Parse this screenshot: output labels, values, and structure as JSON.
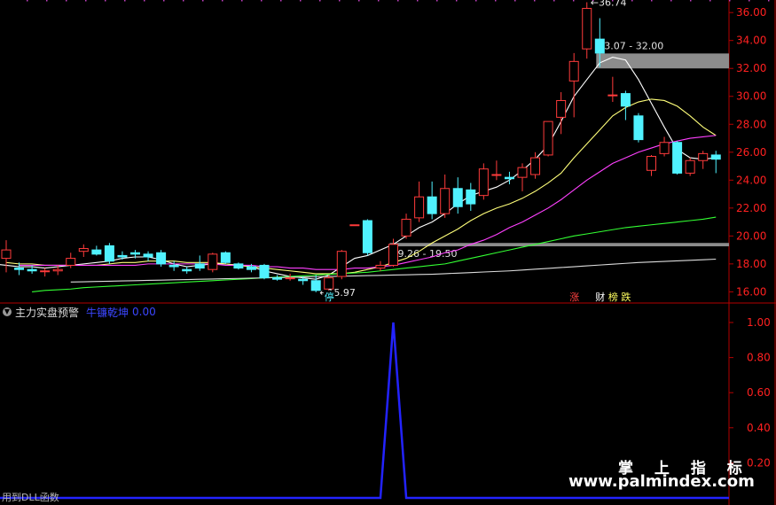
{
  "indicator": {
    "name": "主力实盘预警",
    "signal_label": "牛镰乾坤",
    "signal_value": "0.00"
  },
  "footer_text": "用到DLL函数",
  "watermark": {
    "title": "掌 上 指 标",
    "url": "www.palmindex.com"
  },
  "colors": {
    "up": "#ff3b3b",
    "down": "#50f2ff",
    "ma5": "#ffffff",
    "ma10": "#ffff7a",
    "ma20": "#ff40ff",
    "ma60": "#33ff33",
    "ma120": "#dcdcdc",
    "signal": "#2323ff",
    "axis": "#b40000",
    "level": "#8c8c8c"
  },
  "chart_data": [
    {
      "type": "candlestick",
      "y_axis_ticks": [
        "16.00",
        "18.00",
        "20.00",
        "22.00",
        "24.00",
        "26.00",
        "28.00",
        "30.00",
        "32.00",
        "34.00",
        "36.00"
      ],
      "ylim": [
        15.2,
        36.9
      ],
      "candles": [
        [
          18.4,
          19.7,
          19.0,
          17.4
        ],
        [
          17.7,
          18.1,
          17.6,
          17.2
        ],
        [
          17.6,
          17.9,
          17.5,
          17.3
        ],
        [
          17.5,
          17.7,
          17.5,
          17.1
        ],
        [
          17.5,
          17.9,
          17.6,
          17.2
        ],
        [
          17.9,
          18.8,
          18.4,
          17.7
        ],
        [
          18.9,
          19.4,
          19.1,
          18.5
        ],
        [
          19.0,
          19.3,
          18.7,
          18.6
        ],
        [
          19.3,
          19.5,
          18.2,
          18.0
        ],
        [
          18.6,
          18.9,
          18.5,
          18.3
        ],
        [
          18.8,
          19.0,
          18.7,
          18.4
        ],
        [
          18.7,
          18.9,
          18.5,
          18.2
        ],
        [
          18.8,
          19.0,
          18.0,
          17.8
        ],
        [
          17.9,
          18.2,
          17.8,
          17.5
        ],
        [
          17.6,
          17.8,
          17.5,
          17.3
        ],
        [
          18.0,
          18.6,
          17.7,
          17.5
        ],
        [
          17.6,
          18.8,
          18.7,
          17.4
        ],
        [
          18.8,
          18.9,
          18.1,
          18.0
        ],
        [
          18.0,
          18.1,
          17.7,
          17.6
        ],
        [
          17.8,
          18.0,
          17.6,
          17.4
        ],
        [
          17.9,
          18.0,
          17.0,
          16.9
        ],
        [
          17.0,
          17.2,
          16.9,
          16.8
        ],
        [
          17.0,
          17.3,
          17.0,
          16.8
        ],
        [
          16.9,
          17.1,
          16.8,
          16.5
        ],
        [
          16.8,
          17.2,
          16.1,
          15.97
        ],
        [
          16.2,
          17.2,
          17.0,
          16.0
        ],
        [
          17.1,
          19.0,
          18.9,
          16.9
        ],
        [
          20.8,
          20.8,
          20.8,
          20.8
        ],
        [
          21.1,
          21.2,
          18.8,
          18.6
        ],
        [
          17.7,
          18.2,
          17.9,
          17.5
        ],
        [
          17.9,
          19.8,
          19.4,
          17.8
        ],
        [
          20.0,
          21.6,
          21.2,
          19.8
        ],
        [
          21.3,
          23.9,
          22.8,
          21.0
        ],
        [
          22.8,
          23.9,
          21.6,
          21.2
        ],
        [
          21.6,
          24.4,
          23.4,
          21.3
        ],
        [
          23.4,
          24.2,
          22.1,
          21.6
        ],
        [
          23.3,
          23.8,
          22.3,
          21.8
        ],
        [
          22.9,
          25.2,
          24.8,
          22.6
        ],
        [
          24.4,
          25.4,
          24.4,
          24.0
        ],
        [
          24.2,
          24.6,
          24.1,
          23.7
        ],
        [
          24.2,
          25.2,
          24.9,
          23.2
        ],
        [
          24.4,
          26.0,
          25.6,
          24.1
        ],
        [
          25.8,
          28.2,
          28.2,
          25.7
        ],
        [
          28.5,
          30.3,
          29.7,
          27.3
        ],
        [
          31.1,
          33.1,
          32.5,
          28.5
        ],
        [
          33.4,
          36.74,
          36.3,
          32.7
        ],
        [
          34.1,
          35.6,
          33.1,
          32.1
        ],
        [
          30.1,
          31.4,
          30.1,
          29.6
        ],
        [
          30.2,
          30.4,
          29.3,
          28.3
        ],
        [
          28.6,
          28.8,
          26.9,
          26.7
        ],
        [
          24.7,
          25.8,
          25.7,
          24.3
        ],
        [
          25.9,
          27.1,
          26.7,
          25.7
        ],
        [
          26.7,
          26.8,
          24.5,
          24.4
        ],
        [
          24.5,
          25.6,
          25.4,
          24.3
        ],
        [
          25.4,
          26.1,
          25.9,
          24.8
        ],
        [
          25.8,
          26.1,
          25.5,
          24.5
        ]
      ],
      "ma_series": [
        {
          "values": [
            18.0,
            17.9,
            17.8,
            17.8,
            17.7,
            17.8,
            17.9,
            18.0,
            18.1,
            18.2,
            18.4,
            18.5,
            18.5,
            18.3,
            18.0,
            17.8,
            17.9,
            18.0,
            18.0,
            17.9,
            17.8,
            17.5,
            17.3,
            17.1,
            17.0,
            16.9,
            17.2,
            17.8,
            18.4,
            18.6,
            19.0,
            19.4,
            20.0,
            20.6,
            21.0,
            21.6,
            22.3,
            22.9,
            23.2,
            23.5,
            24.0,
            24.7,
            25.5,
            26.5,
            28.2,
            30.0,
            31.2,
            32.4,
            32.8,
            32.6,
            31.2,
            29.5,
            27.8,
            26.2,
            25.6,
            25.5,
            25.6
          ],
          "style": "ma5"
        },
        {
          "values": [
            18.1,
            18.0,
            18.0,
            17.9,
            17.9,
            17.9,
            17.9,
            17.9,
            18.0,
            18.1,
            18.1,
            18.2,
            18.2,
            18.2,
            18.1,
            18.1,
            18.1,
            18.0,
            17.9,
            17.8,
            17.7,
            17.6,
            17.5,
            17.4,
            17.3,
            17.3,
            17.3,
            17.4,
            17.6,
            17.8,
            18.1,
            18.4,
            18.9,
            19.5,
            20.0,
            20.5,
            21.1,
            21.6,
            22.0,
            22.3,
            22.7,
            23.2,
            23.8,
            24.5,
            25.6,
            26.6,
            27.6,
            28.6,
            29.2,
            29.6,
            29.8,
            29.7,
            29.3,
            28.6,
            27.8,
            27.2
          ],
          "style": "ma10"
        },
        {
          "values": [
            17.9,
            17.9,
            17.9,
            17.9,
            17.9,
            17.9,
            17.9,
            17.9,
            17.9,
            17.9,
            18.0,
            18.0,
            18.0,
            18.0,
            18.0,
            18.0,
            17.9,
            17.9,
            17.9,
            17.8,
            17.8,
            17.7,
            17.7,
            17.6,
            17.6,
            17.6,
            17.7,
            17.7,
            17.8,
            17.9,
            18.1,
            18.3,
            18.5,
            18.8,
            19.0,
            19.4,
            19.7,
            20.1,
            20.6,
            21.0,
            21.5,
            22.0,
            22.6,
            23.3,
            24.0,
            24.6,
            25.2,
            25.6,
            26.0,
            26.3,
            26.6,
            26.8,
            27.0,
            27.1,
            27.2
          ],
          "style": "ma20"
        },
        {
          "values": [
            16.0,
            16.1,
            16.15,
            16.2,
            16.3,
            16.35,
            16.4,
            16.45,
            16.5,
            16.55,
            16.6,
            16.65,
            16.7,
            16.75,
            16.8,
            16.85,
            16.9,
            16.95,
            17.0,
            17.05,
            17.1,
            17.15,
            17.2,
            17.25,
            17.3,
            17.35,
            17.4,
            17.5,
            17.6,
            17.7,
            17.8,
            17.9,
            18.0,
            18.2,
            18.4,
            18.6,
            18.8,
            19.0,
            19.2,
            19.4,
            19.6,
            19.8,
            20.0,
            20.15,
            20.3,
            20.45,
            20.6,
            20.7,
            20.8,
            20.9,
            21.0,
            21.1,
            21.2,
            21.35
          ],
          "style": "ma60"
        },
        {
          "values": [
            16.7,
            16.72,
            16.74,
            16.76,
            16.78,
            16.8,
            16.82,
            16.84,
            16.86,
            16.88,
            16.9,
            16.92,
            16.94,
            16.96,
            16.98,
            17.0,
            17.02,
            17.04,
            17.06,
            17.08,
            17.1,
            17.12,
            17.14,
            17.16,
            17.18,
            17.2,
            17.22,
            17.24,
            17.26,
            17.3,
            17.34,
            17.38,
            17.42,
            17.46,
            17.5,
            17.56,
            17.62,
            17.68,
            17.74,
            17.8,
            17.86,
            17.92,
            17.98,
            18.04,
            18.1,
            18.14,
            18.18,
            18.22,
            18.26,
            18.3,
            18.34
          ],
          "style": "ma120"
        }
      ],
      "levels": [
        {
          "low": 32.0,
          "high": 33.07,
          "label": "33.07 - 32.00"
        },
        {
          "low": 19.26,
          "high": 19.5,
          "label": "19.26 - 19.50"
        }
      ],
      "annotations": [
        {
          "label": "36.74",
          "index": 45,
          "value": 36.74
        },
        {
          "label": "15.97",
          "index": 24,
          "value": 15.97
        }
      ],
      "event_tags": [
        {
          "label": "停",
          "index": 25
        },
        {
          "label": "涨",
          "index": 44
        },
        {
          "label": "财",
          "index": 46
        },
        {
          "label": "榜",
          "index": 47
        },
        {
          "label": "跌",
          "index": 48
        }
      ]
    },
    {
      "type": "line",
      "y_axis_ticks": [
        "0.20",
        "0.40",
        "0.60",
        "0.80",
        "1.00"
      ],
      "ylim": [
        0,
        1.0
      ],
      "values": [
        0,
        0,
        0,
        0,
        0,
        0,
        0,
        0,
        0,
        0,
        0,
        0,
        0,
        0,
        0,
        0,
        0,
        0,
        0,
        0,
        0,
        0,
        0,
        0,
        0,
        0,
        0,
        0,
        0,
        0,
        1,
        0,
        0,
        0,
        0,
        0,
        0,
        0,
        0,
        0,
        0,
        0,
        0,
        0,
        0,
        0,
        0,
        0,
        0,
        0,
        0,
        0,
        0,
        0,
        0,
        0
      ]
    }
  ]
}
